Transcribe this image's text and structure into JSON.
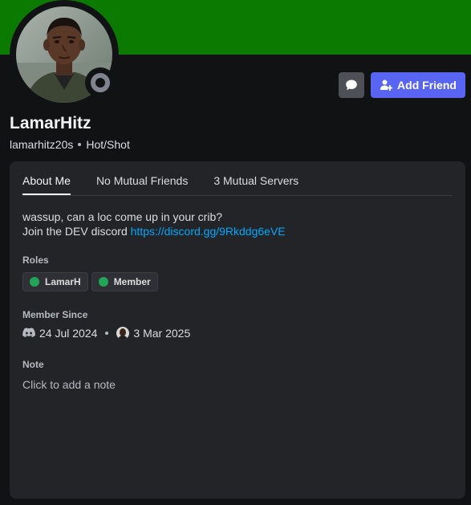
{
  "profile": {
    "display_name": "LamarHitz",
    "username": "lamarhitz20s",
    "pronouns": "Hot/Shot",
    "status": "offline",
    "banner_color": "#0b7a00"
  },
  "actions": {
    "message_icon": "chat-bubble-icon",
    "add_friend_label": "Add Friend",
    "add_friend_icon": "add-user-icon"
  },
  "tabs": [
    {
      "label": "About Me",
      "active": true
    },
    {
      "label": "No Mutual Friends",
      "active": false
    },
    {
      "label": "3 Mutual Servers",
      "active": false
    }
  ],
  "about": {
    "line1": "wassup, can a loc come up in your crib?",
    "line2_prefix": "Join the DEV discord ",
    "link": "https://discord.gg/9Rkddg6eVE"
  },
  "roles": {
    "label": "Roles",
    "items": [
      {
        "name": "LamarH",
        "color": "#23a559"
      },
      {
        "name": "Member",
        "color": "#23a559"
      }
    ]
  },
  "member_since": {
    "label": "Member Since",
    "discord_date": "24 Jul 2024",
    "server_date": "3 Mar 2025"
  },
  "note": {
    "label": "Note",
    "placeholder": "Click to add a note"
  }
}
